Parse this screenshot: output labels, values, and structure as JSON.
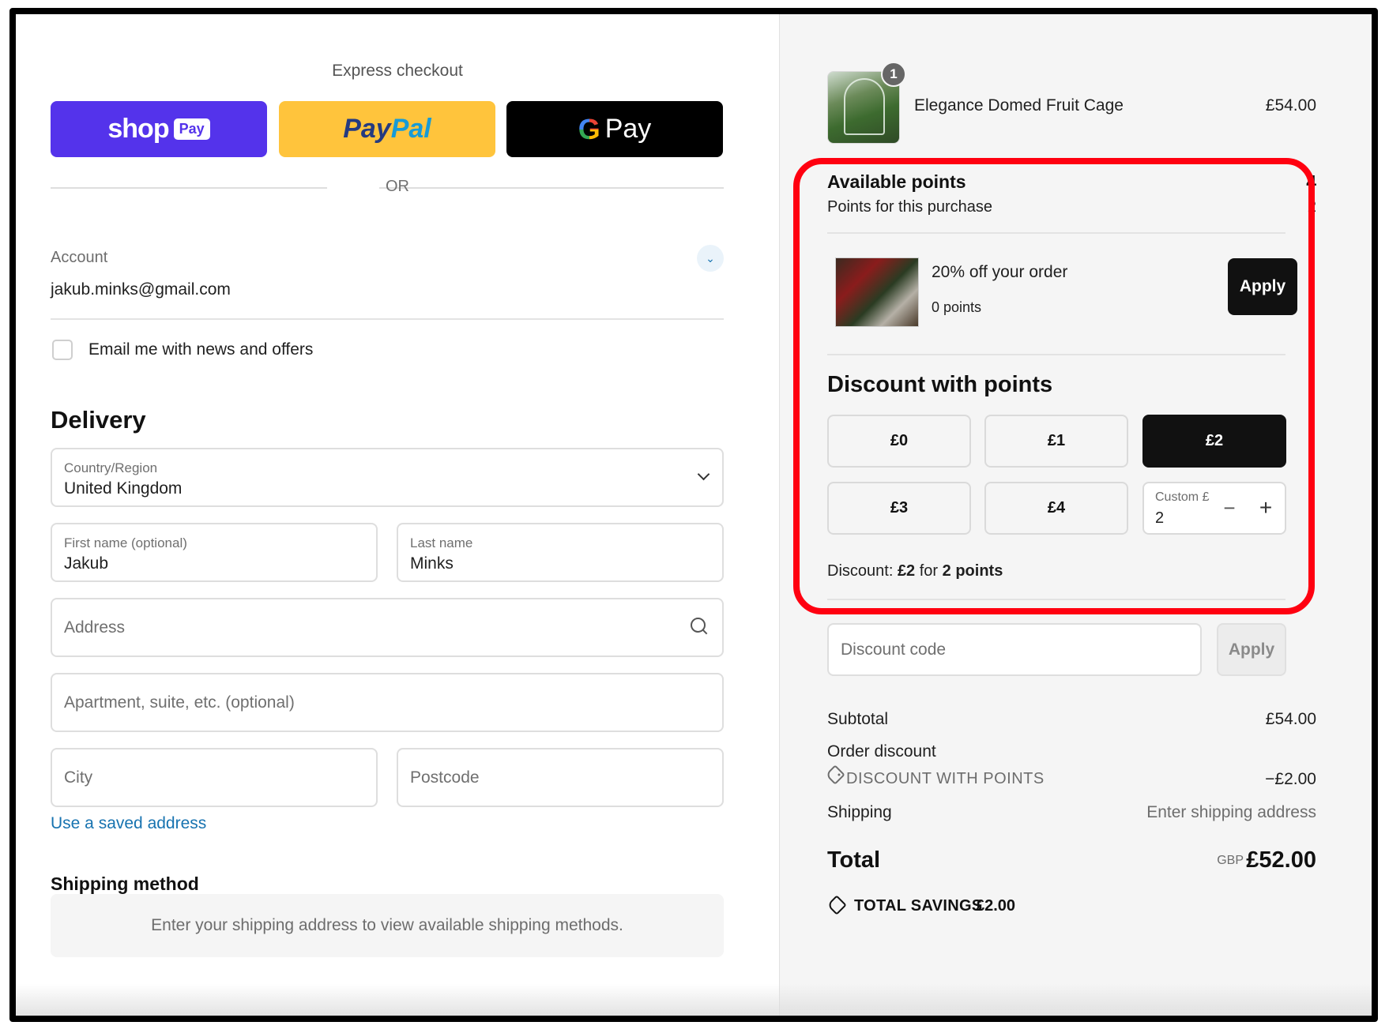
{
  "express": {
    "title": "Express checkout",
    "shop_pay_word": "shop",
    "shop_pay_badge": "Pay",
    "paypal_pay": "Pay",
    "paypal_pal": "Pal",
    "gpay_g": "G",
    "gpay_word": "Pay",
    "or": "OR"
  },
  "account": {
    "label": "Account",
    "email": "jakub.minks@gmail.com",
    "news_label": "Email me with news and offers"
  },
  "delivery": {
    "title": "Delivery",
    "country_label": "Country/Region",
    "country_value": "United Kingdom",
    "first_name_label": "First name (optional)",
    "first_name_value": "Jakub",
    "last_name_label": "Last name",
    "last_name_value": "Minks",
    "address_placeholder": "Address",
    "apartment_placeholder": "Apartment, suite, etc. (optional)",
    "city_placeholder": "City",
    "postcode_placeholder": "Postcode",
    "saved_address_link": "Use a saved address"
  },
  "shipping": {
    "title": "Shipping method",
    "notice": "Enter your shipping address to view available shipping methods."
  },
  "product": {
    "quantity": "1",
    "name": "Elegance Domed Fruit Cage",
    "price": "£54.00"
  },
  "points": {
    "available_label": "Available points",
    "available_value": "4",
    "purchase_label": "Points for this purchase",
    "purchase_value": "2",
    "reward_title": "20% off your order",
    "reward_points": "0 points",
    "reward_apply": "Apply",
    "discount_title": "Discount with points",
    "options": [
      "£0",
      "£1",
      "£2",
      "£3",
      "£4"
    ],
    "selected_option": "£2",
    "custom_label": "Custom £",
    "custom_value": "2",
    "summary_prefix": "Discount:",
    "summary_amount": "£2",
    "summary_mid": "for",
    "summary_points": "2 points"
  },
  "discount_code": {
    "placeholder": "Discount code",
    "apply": "Apply"
  },
  "summary": {
    "subtotal_label": "Subtotal",
    "subtotal_value": "£54.00",
    "order_discount_label": "Order discount",
    "discount_name": "DISCOUNT WITH POINTS",
    "discount_value": "−£2.00",
    "shipping_label": "Shipping",
    "shipping_value": "Enter shipping address",
    "total_label": "Total",
    "total_currency": "GBP",
    "total_value": "£52.00",
    "savings_label": "TOTAL SAVINGS",
    "savings_value": "£2.00"
  },
  "colors": {
    "shop_pay": "#5433eb",
    "paypal": "#ffc43c",
    "link": "#1773b0",
    "highlight": "#ff0010"
  }
}
